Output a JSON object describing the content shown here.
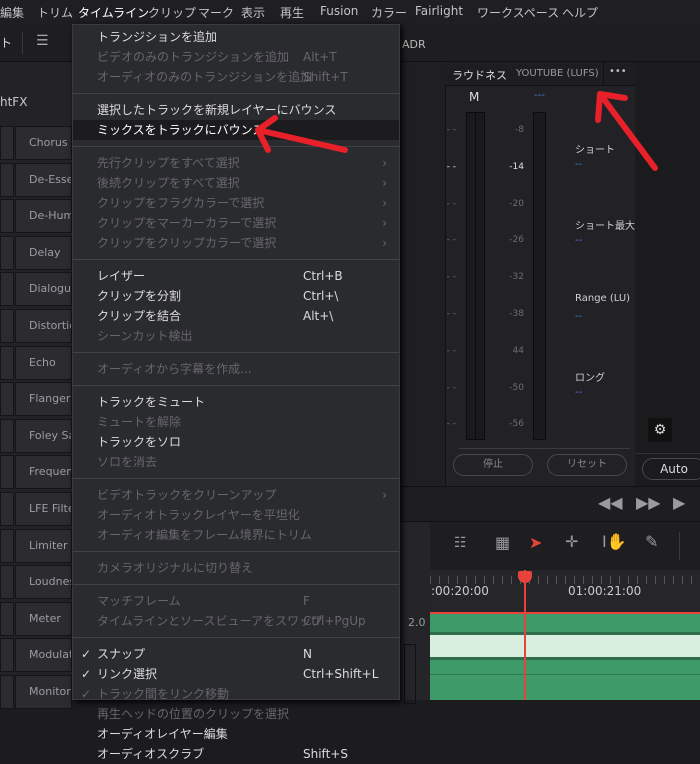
{
  "menubar": [
    "編集",
    "トリム",
    "タイムライン",
    "クリップ",
    "マーク",
    "表示",
    "再生",
    "Fusion",
    "カラー",
    "Fairlight",
    "ワークスペース",
    "ヘルプ"
  ],
  "toolbar": {
    "left_text": "ト",
    "adr": "ADR"
  },
  "left_panel": {
    "title": "htFX",
    "items": [
      "Chorus",
      "De-Esser",
      "De-Hum",
      "Delay",
      "Dialogue",
      "Distortion",
      "Echo",
      "Flanger",
      "Foley Sa",
      "Frequen",
      "LFE Filter",
      "Limiter",
      "Loudness",
      "Meter",
      "Modulat",
      "Monitor"
    ]
  },
  "menu": {
    "groups": [
      [
        {
          "label": "トランジションを追加",
          "enabled": true
        },
        {
          "label": "ビデオのみのトランジションを追加",
          "shortcut": "Alt+T",
          "enabled": false
        },
        {
          "label": "オーディオのみのトランジションを追加",
          "shortcut": "Shift+T",
          "enabled": false
        }
      ],
      [
        {
          "label": "選択したトラックを新規レイヤーにバウンス",
          "enabled": true
        },
        {
          "label": "ミックスをトラックにバウンス...",
          "enabled": true,
          "highlighted": true
        }
      ],
      [
        {
          "label": "先行クリップをすべて選択",
          "enabled": false,
          "submenu": true
        },
        {
          "label": "後続クリップをすべて選択",
          "enabled": false,
          "submenu": true
        },
        {
          "label": "クリップをフラグカラーで選択",
          "enabled": false,
          "submenu": true
        },
        {
          "label": "クリップをマーカーカラーで選択",
          "enabled": false,
          "submenu": true
        },
        {
          "label": "クリップをクリップカラーで選択",
          "enabled": false,
          "submenu": true
        }
      ],
      [
        {
          "label": "レイザー",
          "shortcut": "Ctrl+B",
          "enabled": true
        },
        {
          "label": "クリップを分割",
          "shortcut": "Ctrl+\\",
          "enabled": true
        },
        {
          "label": "クリップを結合",
          "shortcut": "Alt+\\",
          "enabled": true
        },
        {
          "label": "シーンカット検出",
          "enabled": false
        }
      ],
      [
        {
          "label": "オーディオから字幕を作成...",
          "enabled": false
        }
      ],
      [
        {
          "label": "トラックをミュート",
          "enabled": true
        },
        {
          "label": "ミュートを解除",
          "enabled": false
        },
        {
          "label": "トラックをソロ",
          "enabled": true
        },
        {
          "label": "ソロを消去",
          "enabled": false
        }
      ],
      [
        {
          "label": "ビデオトラックをクリーンアップ",
          "enabled": false,
          "submenu": true
        },
        {
          "label": "オーディオトラックレイヤーを平坦化",
          "enabled": false
        },
        {
          "label": "オーディオ編集をフレーム境界にトリム",
          "enabled": false
        }
      ],
      [
        {
          "label": "カメラオリジナルに切り替え",
          "enabled": false
        }
      ],
      [
        {
          "label": "マッチフレーム",
          "shortcut": "F",
          "enabled": false
        },
        {
          "label": "タイムラインとソースビューアをスワップ",
          "shortcut": "Ctrl+PgUp",
          "enabled": false
        }
      ],
      [
        {
          "label": "スナップ",
          "shortcut": "N",
          "enabled": true,
          "checked": true
        },
        {
          "label": "リンク選択",
          "shortcut": "Ctrl+Shift+L",
          "enabled": true,
          "checked": true
        },
        {
          "label": "トラック間をリンク移動",
          "enabled": false,
          "checked": true
        },
        {
          "label": "再生ヘッドの位置のクリップを選択",
          "enabled": false
        },
        {
          "label": "オーディオレイヤー編集",
          "enabled": true
        },
        {
          "label": "オーディオスクラブ",
          "shortcut": "Shift+S",
          "enabled": true
        }
      ]
    ]
  },
  "loudness": {
    "title": "ラウドネス",
    "standard": "YOUTUBE (LUFS)",
    "more": "•••",
    "meter_label": "M",
    "meter_value": "---",
    "scale": [
      "-8",
      "-14",
      "-20",
      "-26",
      "-32",
      "-38",
      "44",
      "-50",
      "-56"
    ],
    "readouts": [
      {
        "label": "ショート",
        "value": "--"
      },
      {
        "label": "ショート最大",
        "value": "--"
      },
      {
        "label": "Range (LU)",
        "value": "--"
      },
      {
        "label": "ロング",
        "value": "--"
      }
    ],
    "stop": "停止",
    "reset": "リセット"
  },
  "auto_button": "Auto",
  "timeline": {
    "timecodes": [
      ":00:20:00",
      "01:00:21:00"
    ],
    "track_format": "2.0"
  },
  "colors": {
    "accent": "#e8433a",
    "track": "#3f9a6a",
    "annotation": "#e8202a"
  }
}
